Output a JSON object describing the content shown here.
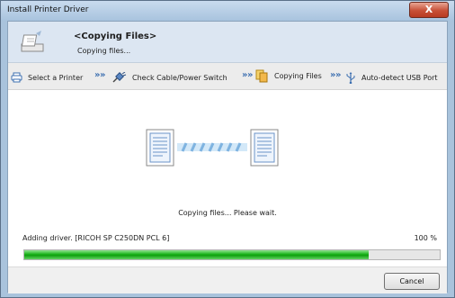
{
  "window": {
    "title": "Install Printer Driver",
    "close_glyph": "X"
  },
  "header": {
    "icon": "installer-icon",
    "title": "<Copying Files>",
    "subtitle": "Copying files..."
  },
  "steps": [
    {
      "label": "Select a Printer",
      "icon": "printer-icon"
    },
    {
      "label": "Check Cable/Power Switch",
      "icon": "cable-plug-icon"
    },
    {
      "label": "Copying Files",
      "icon": "copy-files-icon"
    },
    {
      "label": "Auto-detect USB Port",
      "icon": "usb-icon"
    }
  ],
  "step_separator": "»",
  "status_text": "Copying files... Please wait.",
  "progress": {
    "label": "Adding driver. [RICOH SP C250DN PCL 6]",
    "percent_text": "100 %",
    "fill_fraction": 0.83
  },
  "footer": {
    "cancel_label": "Cancel"
  },
  "colors": {
    "progress": "#19b419",
    "header_bg": "#dce6f2",
    "chevron": "#3c6fb0"
  }
}
